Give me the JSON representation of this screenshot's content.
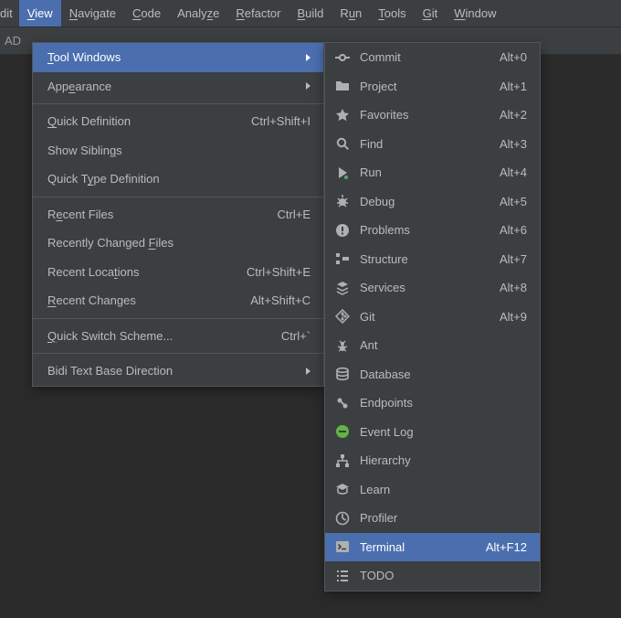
{
  "menubar": {
    "items": [
      {
        "pre": "",
        "u": "",
        "post": "dit"
      },
      {
        "pre": "",
        "u": "V",
        "post": "iew",
        "active": true
      },
      {
        "pre": "",
        "u": "N",
        "post": "avigate"
      },
      {
        "pre": "",
        "u": "C",
        "post": "ode"
      },
      {
        "pre": "Analy",
        "u": "z",
        "post": "e"
      },
      {
        "pre": "",
        "u": "R",
        "post": "efactor"
      },
      {
        "pre": "",
        "u": "B",
        "post": "uild"
      },
      {
        "pre": "R",
        "u": "u",
        "post": "n"
      },
      {
        "pre": "",
        "u": "T",
        "post": "ools"
      },
      {
        "pre": "",
        "u": "G",
        "post": "it"
      },
      {
        "pre": "",
        "u": "W",
        "post": "indow"
      }
    ]
  },
  "toolbar": {
    "text": "AD"
  },
  "view_menu": {
    "items": [
      {
        "pre": "",
        "u": "T",
        "post": "ool Windows",
        "shortcut": "",
        "submenu": true,
        "selected": true
      },
      {
        "pre": "App",
        "u": "e",
        "post": "arance",
        "shortcut": "",
        "submenu": true
      },
      {
        "sep": true
      },
      {
        "pre": "",
        "u": "Q",
        "post": "uick Definition",
        "shortcut": "Ctrl+Shift+I"
      },
      {
        "pre": "Show Siblin",
        "u": "g",
        "post": "s",
        "shortcut": ""
      },
      {
        "pre": "Quick T",
        "u": "y",
        "post": "pe Definition",
        "shortcut": ""
      },
      {
        "sep": true
      },
      {
        "pre": "R",
        "u": "e",
        "post": "cent Files",
        "shortcut": "Ctrl+E"
      },
      {
        "pre": "Recently Changed ",
        "u": "F",
        "post": "iles",
        "shortcut": ""
      },
      {
        "pre": "Recent Loca",
        "u": "t",
        "post": "ions",
        "shortcut": "Ctrl+Shift+E"
      },
      {
        "pre": "",
        "u": "R",
        "post": "ecent Changes",
        "shortcut": "Alt+Shift+C"
      },
      {
        "sep": true
      },
      {
        "pre": "",
        "u": "Q",
        "post": "uick Switch Scheme...",
        "shortcut": "Ctrl+`"
      },
      {
        "sep": true
      },
      {
        "pre": "Bidi Text Base Direction",
        "u": "",
        "post": "",
        "shortcut": "",
        "submenu": true
      }
    ]
  },
  "tool_windows_menu": {
    "items": [
      {
        "icon": "commit",
        "label": "Commit",
        "shortcut": "Alt+0"
      },
      {
        "icon": "project",
        "label": "Project",
        "shortcut": "Alt+1"
      },
      {
        "icon": "favorites",
        "label": "Favorites",
        "shortcut": "Alt+2"
      },
      {
        "icon": "find",
        "label": "Find",
        "shortcut": "Alt+3"
      },
      {
        "icon": "run",
        "label": "Run",
        "shortcut": "Alt+4"
      },
      {
        "icon": "debug",
        "label": "Debug",
        "shortcut": "Alt+5"
      },
      {
        "icon": "problems",
        "label": "Problems",
        "shortcut": "Alt+6"
      },
      {
        "icon": "structure",
        "label": "Structure",
        "shortcut": "Alt+7"
      },
      {
        "icon": "services",
        "label": "Services",
        "shortcut": "Alt+8"
      },
      {
        "icon": "git",
        "label": "Git",
        "shortcut": "Alt+9"
      },
      {
        "icon": "ant",
        "label": "Ant",
        "shortcut": ""
      },
      {
        "icon": "database",
        "label": "Database",
        "shortcut": ""
      },
      {
        "icon": "endpoints",
        "label": "Endpoints",
        "shortcut": ""
      },
      {
        "icon": "eventlog",
        "label": "Event Log",
        "shortcut": ""
      },
      {
        "icon": "hierarchy",
        "label": "Hierarchy",
        "shortcut": ""
      },
      {
        "icon": "learn",
        "label": "Learn",
        "shortcut": ""
      },
      {
        "icon": "profiler",
        "label": "Profiler",
        "shortcut": ""
      },
      {
        "icon": "terminal",
        "label": "Terminal",
        "shortcut": "Alt+F12",
        "selected": true
      },
      {
        "icon": "todo",
        "label": "TODO",
        "shortcut": ""
      }
    ]
  }
}
